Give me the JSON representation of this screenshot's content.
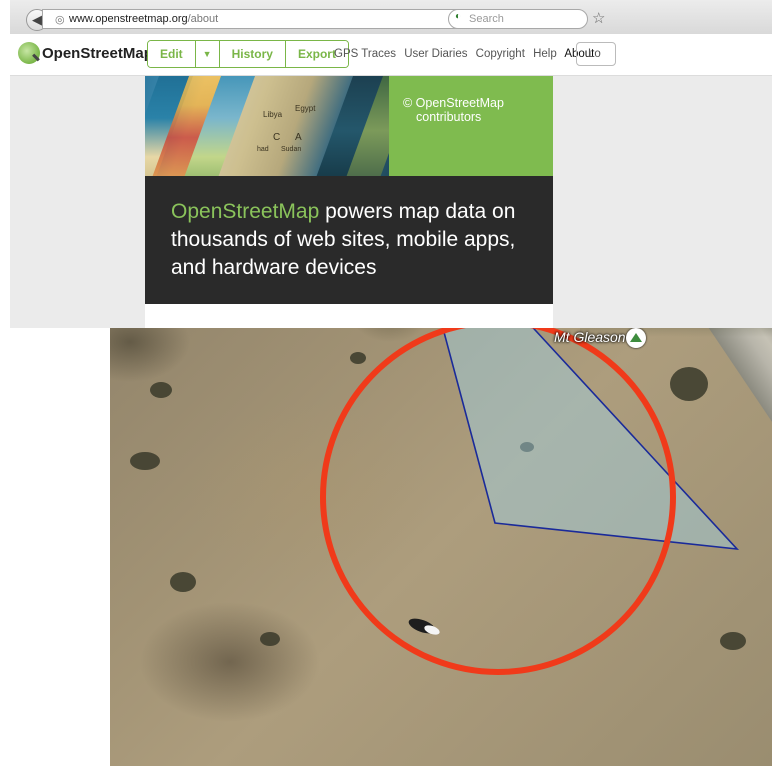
{
  "browser": {
    "url": {
      "domain": "www.openstreetmap.org",
      "path": "/about"
    },
    "search_placeholder": "Search"
  },
  "osm_header": {
    "logo_text": "OpenStreetMap",
    "edit_buttons": [
      "Edit",
      "History",
      "Export"
    ],
    "nav_links": [
      "GPS Traces",
      "User Diaries",
      "Copyright",
      "Help",
      "About"
    ],
    "active_link": "About",
    "login_label": "Lo"
  },
  "about": {
    "map_labels": [
      "Libya",
      "Egypt",
      "C",
      "A",
      "had",
      "Sudan"
    ],
    "copyright_line1": "© OpenStreetMap",
    "copyright_line2": "contributors",
    "tagline_brand": "OpenStreetMap",
    "tagline_rest": " powers map data on thousands of web sites, mobile apps, and hardware devices"
  },
  "satellite": {
    "peak_label": "Mt Gleason",
    "colors": {
      "circle": "#f03a1a",
      "triangle_stroke": "#1a2a9a",
      "triangle_fill": "#9fd2e6"
    }
  }
}
